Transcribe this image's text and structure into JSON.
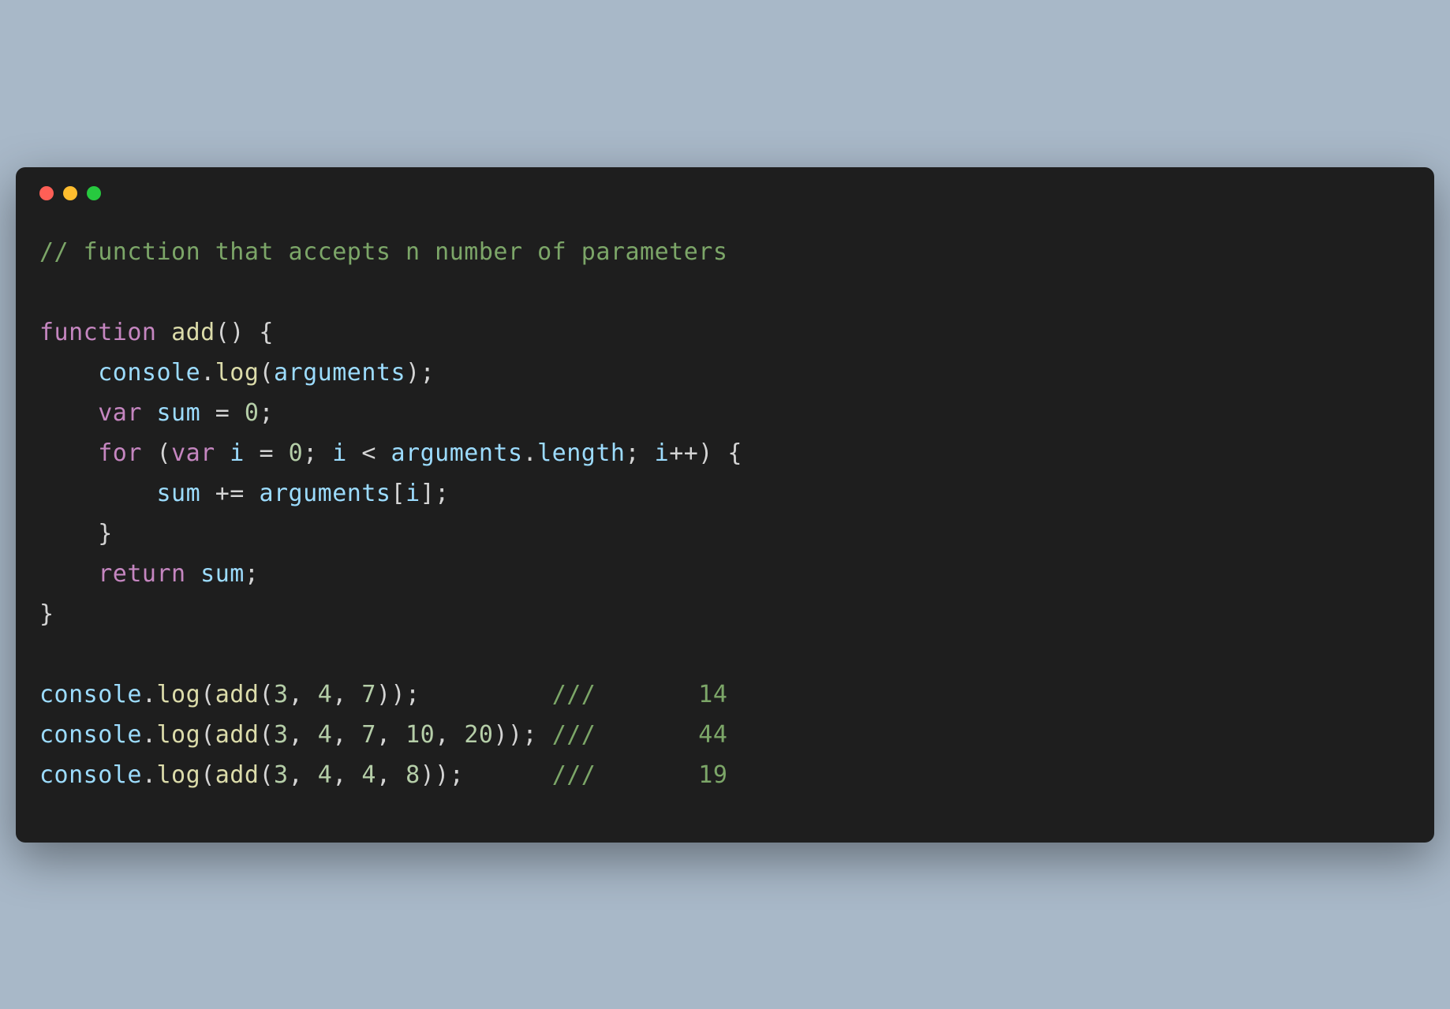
{
  "window": {
    "controls": {
      "close": "close",
      "minimize": "minimize",
      "maximize": "maximize"
    }
  },
  "code": {
    "line1_comment": "// function that accepts n number of parameters",
    "line3_function": "function",
    "line3_name": "add",
    "line3_parens": "()",
    "line3_brace": " {",
    "line4_indent": "    ",
    "line4_console": "console",
    "line4_dot": ".",
    "line4_log": "log",
    "line4_open": "(",
    "line4_args": "arguments",
    "line4_close": ");",
    "line5_indent": "    ",
    "line5_var": "var",
    "line5_sum": " sum ",
    "line5_eq": "= ",
    "line5_zero": "0",
    "line5_semi": ";",
    "line6_indent": "    ",
    "line6_for": "for",
    "line6_space": " (",
    "line6_var": "var",
    "line6_i": " i ",
    "line6_eq": "= ",
    "line6_zero": "0",
    "line6_semi1": "; ",
    "line6_i2": "i ",
    "line6_lt": "< ",
    "line6_args": "arguments",
    "line6_dot": ".",
    "line6_length": "length",
    "line6_semi2": "; ",
    "line6_i3": "i",
    "line6_inc": "++) {",
    "line7_indent": "        ",
    "line7_sum": "sum ",
    "line7_pluseq": "+= ",
    "line7_args": "arguments",
    "line7_bracket": "[",
    "line7_i": "i",
    "line7_close": "];",
    "line8_indent": "    ",
    "line8_brace": "}",
    "line9_indent": "    ",
    "line9_return": "return",
    "line9_sum": " sum",
    "line9_semi": ";",
    "line10_brace": "}",
    "line12_console": "console",
    "line12_dot": ".",
    "line12_log": "log",
    "line12_open": "(",
    "line12_add": "add",
    "line12_open2": "(",
    "line12_n1": "3",
    "line12_c1": ", ",
    "line12_n2": "4",
    "line12_c2": ", ",
    "line12_n3": "7",
    "line12_close": "));         ",
    "line12_comment": "///       14",
    "line13_console": "console",
    "line13_dot": ".",
    "line13_log": "log",
    "line13_open": "(",
    "line13_add": "add",
    "line13_open2": "(",
    "line13_n1": "3",
    "line13_c1": ", ",
    "line13_n2": "4",
    "line13_c2": ", ",
    "line13_n3": "7",
    "line13_c3": ", ",
    "line13_n4": "10",
    "line13_c4": ", ",
    "line13_n5": "20",
    "line13_close": ")); ",
    "line13_comment": "///       44",
    "line14_console": "console",
    "line14_dot": ".",
    "line14_log": "log",
    "line14_open": "(",
    "line14_add": "add",
    "line14_open2": "(",
    "line14_n1": "3",
    "line14_c1": ", ",
    "line14_n2": "4",
    "line14_c2": ", ",
    "line14_n3": "4",
    "line14_c3": ", ",
    "line14_n4": "8",
    "line14_close": "));      ",
    "line14_comment": "///       19"
  }
}
